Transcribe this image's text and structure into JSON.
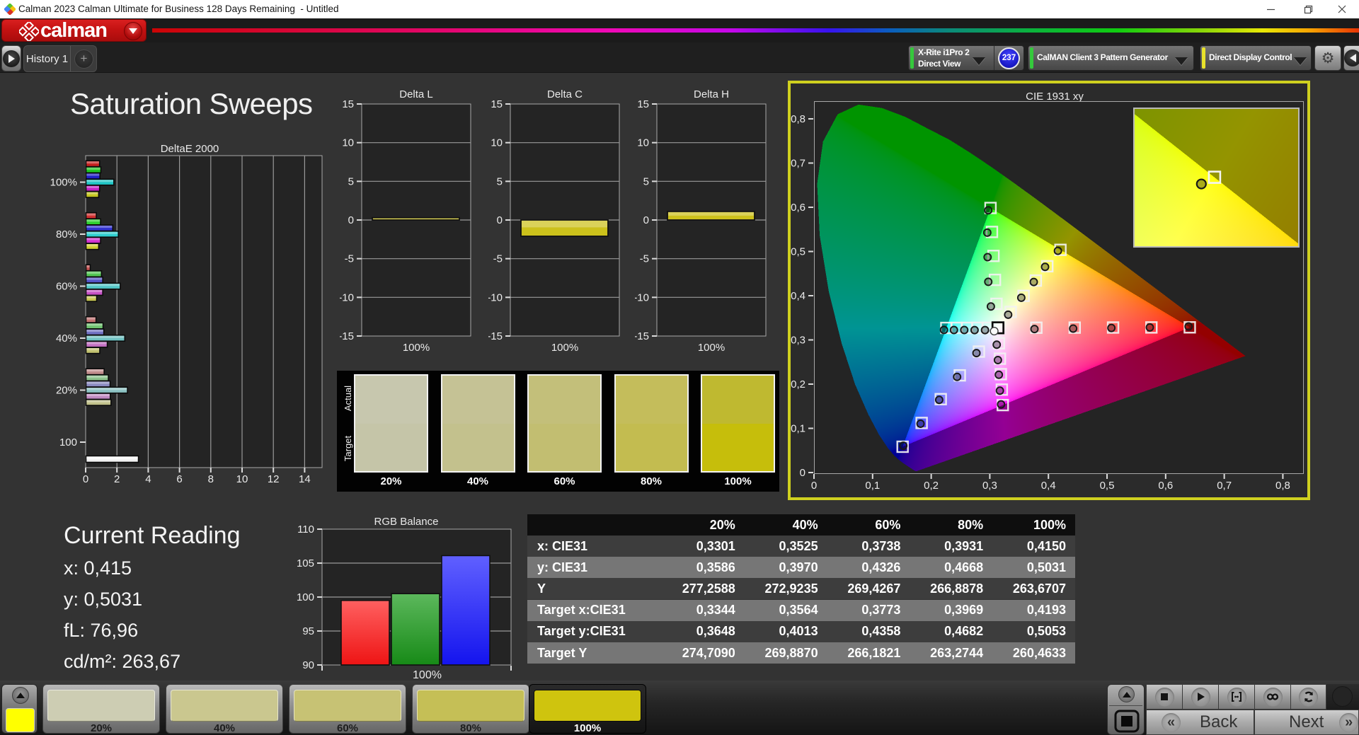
{
  "window": {
    "title": "Calman 2023 Calman Ultimate for Business 128 Days Remaining  - Untitled"
  },
  "brand": {
    "name": "calman"
  },
  "tabs": {
    "active": "History 1",
    "add": "+"
  },
  "toolbar": {
    "meter": {
      "line1": "X-Rite i1Pro 2",
      "line2": "Direct View",
      "badge": "237",
      "accent": "#35c93c"
    },
    "pattern_generator": {
      "label": "CalMAN Client 3 Pattern Generator",
      "accent": "#35c93c"
    },
    "display_control": {
      "label": "Direct Display Control",
      "accent": "#e8e22b"
    }
  },
  "page": {
    "title": "Saturation Sweeps"
  },
  "current_reading": {
    "title": "Current Reading",
    "lines": [
      "x: 0,415",
      "y: 0,5031",
      "fL: 76,96",
      "cd/m²: 263,67"
    ]
  },
  "patch_strip": {
    "row_labels": [
      "Actual",
      "Target"
    ],
    "labels": [
      "20%",
      "40%",
      "60%",
      "80%",
      "100%"
    ],
    "actual_colors": [
      "#c7c7ae",
      "#c5c295",
      "#c3bf7a",
      "#c4bd5b",
      "#bfb930"
    ],
    "target_colors": [
      "#c5c5a8",
      "#c3c18d",
      "#c2be71",
      "#c3bc50",
      "#c6be0b"
    ]
  },
  "table": {
    "headers": [
      "",
      "20%",
      "40%",
      "60%",
      "80%",
      "100%"
    ],
    "rows": [
      {
        "label": "x: CIE31",
        "values": [
          "0,3301",
          "0,3525",
          "0,3738",
          "0,3931",
          "0,4150"
        ]
      },
      {
        "label": "y: CIE31",
        "values": [
          "0,3586",
          "0,3970",
          "0,4326",
          "0,4668",
          "0,5031"
        ]
      },
      {
        "label": "Y",
        "values": [
          "277,2588",
          "272,9235",
          "269,4267",
          "266,8878",
          "263,6707"
        ]
      },
      {
        "label": "Target x:CIE31",
        "values": [
          "0,3344",
          "0,3564",
          "0,3773",
          "0,3969",
          "0,4193"
        ]
      },
      {
        "label": "Target y:CIE31",
        "values": [
          "0,3648",
          "0,4013",
          "0,4358",
          "0,4682",
          "0,5053"
        ]
      },
      {
        "label": "Target Y",
        "values": [
          "274,7090",
          "269,8870",
          "266,1821",
          "263,2744",
          "260,4633"
        ]
      }
    ]
  },
  "bottom_bar": {
    "swatch_color": "#ffff00",
    "patches": [
      {
        "label": "20%",
        "color": "#cdcdb3",
        "selected": false
      },
      {
        "label": "40%",
        "color": "#cac78f",
        "selected": false
      },
      {
        "label": "60%",
        "color": "#c7c274",
        "selected": false
      },
      {
        "label": "80%",
        "color": "#c5bf56",
        "selected": false
      },
      {
        "label": "100%",
        "color": "#cfc40e",
        "selected": true
      }
    ],
    "transport": [
      "stop",
      "play",
      "pattern",
      "loop",
      "refresh"
    ],
    "back_label": "Back",
    "next_label": "Next"
  },
  "chart_data": [
    {
      "id": "deltae2000",
      "type": "bar",
      "title": "DeltaE 2000",
      "orientation": "horizontal",
      "categories": [
        "100%",
        "80%",
        "60%",
        "40%",
        "20%",
        "100"
      ],
      "series": [
        {
          "name": "red",
          "values": [
            0.87,
            0.66,
            0.27,
            0.64,
            1.16,
            null
          ]
        },
        {
          "name": "green",
          "values": [
            0.95,
            0.93,
            0.99,
            1.09,
            1.43,
            null
          ]
        },
        {
          "name": "blue",
          "values": [
            0.89,
            1.71,
            1.07,
            1.14,
            1.54,
            null
          ]
        },
        {
          "name": "cyan",
          "values": [
            1.78,
            2.07,
            2.19,
            2.48,
            2.65,
            null
          ]
        },
        {
          "name": "magenta",
          "values": [
            0.87,
            0.93,
            1.07,
            1.36,
            1.55,
            null
          ]
        },
        {
          "name": "yellow",
          "values": [
            0.81,
            0.81,
            0.68,
            0.88,
            1.6,
            null
          ]
        },
        {
          "name": "white",
          "values": [
            null,
            null,
            null,
            null,
            null,
            3.35
          ]
        }
      ],
      "xlim": [
        0,
        15.1
      ],
      "xticks": [
        0,
        2,
        4,
        6,
        8,
        10,
        12,
        14
      ]
    },
    {
      "id": "delta_l",
      "type": "bar",
      "title": "Delta L",
      "categories": [
        "100%"
      ],
      "values": [
        0.3
      ],
      "ylim": [
        -15,
        15
      ],
      "yticks": [
        15,
        10,
        5,
        0,
        -5,
        -10,
        -15
      ]
    },
    {
      "id": "delta_c",
      "type": "bar",
      "title": "Delta C",
      "categories": [
        "100%"
      ],
      "values": [
        -2.1
      ],
      "ylim": [
        -15,
        15
      ],
      "yticks": [
        15,
        10,
        5,
        0,
        -5,
        -10,
        -15
      ]
    },
    {
      "id": "delta_h",
      "type": "bar",
      "title": "Delta H",
      "categories": [
        "100%"
      ],
      "values": [
        1.1
      ],
      "ylim": [
        -15,
        15
      ],
      "yticks": [
        15,
        10,
        5,
        0,
        -5,
        -10,
        -15
      ]
    },
    {
      "id": "rgb_balance",
      "type": "bar",
      "title": "RGB Balance",
      "categories": [
        "100%"
      ],
      "series": [
        {
          "name": "red",
          "values": [
            99.5
          ]
        },
        {
          "name": "green",
          "values": [
            100.5
          ]
        },
        {
          "name": "blue",
          "values": [
            106.1
          ]
        }
      ],
      "ylim": [
        90,
        110
      ],
      "yticks": [
        110,
        105,
        100,
        95,
        90
      ]
    },
    {
      "id": "cie1931",
      "type": "scatter",
      "title": "CIE 1931 xy",
      "xlabel_ticks": [
        "0",
        "0,1",
        "0,2",
        "0,3",
        "0,4",
        "0,5",
        "0,6",
        "0,7",
        "0,8"
      ],
      "ylabel_ticks": [
        "0",
        "0,1",
        "0,2",
        "0,3",
        "0,4",
        "0,5",
        "0,6",
        "0,7",
        "0,8"
      ],
      "xlim": [
        0,
        0.8333
      ],
      "ylim": [
        0,
        0.84
      ],
      "white_target": [
        0.3127,
        0.329
      ],
      "white_measured": [
        0.3063,
        0.3215
      ],
      "targets": {
        "red": [
          [
            0.3782,
            0.3292
          ],
          [
            0.4436,
            0.3294
          ],
          [
            0.5091,
            0.3296
          ],
          [
            0.5745,
            0.3298
          ],
          [
            0.64,
            0.33
          ]
        ],
        "green": [
          [
            0.3102,
            0.3832
          ],
          [
            0.3076,
            0.4374
          ],
          [
            0.3051,
            0.4916
          ],
          [
            0.3025,
            0.5458
          ],
          [
            0.3,
            0.6
          ]
        ],
        "blue": [
          [
            0.2802,
            0.2752
          ],
          [
            0.2476,
            0.2214
          ],
          [
            0.2151,
            0.1676
          ],
          [
            0.1825,
            0.1138
          ],
          [
            0.15,
            0.06
          ]
        ],
        "cyan": [
          [
            0.2951,
            0.3289
          ],
          [
            0.2775,
            0.3289
          ],
          [
            0.2598,
            0.3288
          ],
          [
            0.2422,
            0.3288
          ],
          [
            0.2246,
            0.3287
          ]
        ],
        "magenta": [
          [
            0.3143,
            0.294
          ],
          [
            0.316,
            0.2591
          ],
          [
            0.3176,
            0.2241
          ],
          [
            0.3193,
            0.1892
          ],
          [
            0.3209,
            0.1542
          ]
        ],
        "yellow": [
          [
            0.3344,
            0.3648
          ],
          [
            0.3564,
            0.4013
          ],
          [
            0.3773,
            0.4358
          ],
          [
            0.3969,
            0.4682
          ],
          [
            0.4193,
            0.5053
          ]
        ]
      },
      "measured": {
        "red": [
          [
            0.375,
            0.3262
          ],
          [
            0.441,
            0.3272
          ],
          [
            0.5062,
            0.3286
          ],
          [
            0.5718,
            0.3298
          ],
          [
            0.638,
            0.332
          ]
        ],
        "green": [
          [
            0.3006,
            0.3772
          ],
          [
            0.2962,
            0.433
          ],
          [
            0.295,
            0.4888
          ],
          [
            0.2945,
            0.5442
          ],
          [
            0.2962,
            0.5948
          ]
        ],
        "blue": [
          [
            0.276,
            0.2718
          ],
          [
            0.243,
            0.218
          ],
          [
            0.2124,
            0.166
          ],
          [
            0.1806,
            0.112
          ],
          [
            0.1512,
            0.0622
          ]
        ],
        "cyan": [
          [
            0.2906,
            0.3238
          ],
          [
            0.2728,
            0.3238
          ],
          [
            0.2552,
            0.324
          ],
          [
            0.2376,
            0.324
          ],
          [
            0.2206,
            0.3242
          ]
        ],
        "magenta": [
          [
            0.3106,
            0.2908
          ],
          [
            0.3126,
            0.256
          ],
          [
            0.3142,
            0.2228
          ],
          [
            0.316,
            0.1868
          ],
          [
            0.318,
            0.1558
          ]
        ],
        "yellow": [
          [
            0.3301,
            0.3586
          ],
          [
            0.3525,
            0.397
          ],
          [
            0.3738,
            0.4326
          ],
          [
            0.3931,
            0.4668
          ],
          [
            0.415,
            0.5031
          ]
        ]
      },
      "inset": {
        "x0": 0.3932,
        "x1": 0.4466,
        "y0": 0.4827,
        "y1": 0.5277,
        "target": [
          0.4193,
          0.5053
        ],
        "measured": [
          0.415,
          0.5031
        ]
      }
    }
  ]
}
